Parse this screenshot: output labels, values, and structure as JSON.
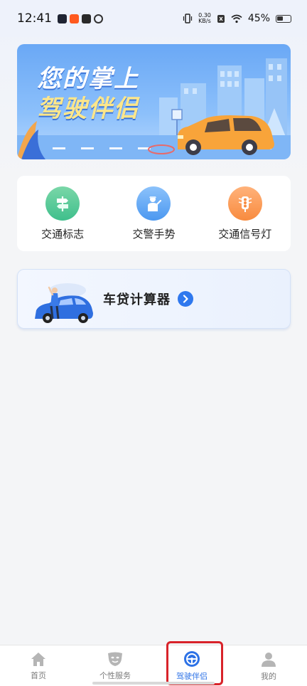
{
  "status_bar": {
    "time": "12:41",
    "net_speed_value": "0.30",
    "net_speed_unit": "KB/s",
    "battery_percent": "45%"
  },
  "banner": {
    "line1": "您的掌上",
    "line2": "驾驶伴侣"
  },
  "services": [
    {
      "label": "交通标志",
      "icon": "signpost-icon",
      "color": "#3fbf8c"
    },
    {
      "label": "交警手势",
      "icon": "traffic-police-icon",
      "color": "#4b98f0"
    },
    {
      "label": "交通信号灯",
      "icon": "traffic-light-icon",
      "color": "#f88b3f"
    }
  ],
  "loan_calculator": {
    "label": "车贷计算器"
  },
  "tabbar": {
    "items": [
      {
        "label": "首页",
        "icon": "home-icon"
      },
      {
        "label": "个性服务",
        "icon": "mask-icon"
      },
      {
        "label": "驾驶伴侣",
        "icon": "steering-wheel-icon",
        "active": true
      },
      {
        "label": "我的",
        "icon": "user-icon"
      }
    ],
    "active_color": "#2d72e6",
    "inactive_color": "#b5b5b5"
  }
}
